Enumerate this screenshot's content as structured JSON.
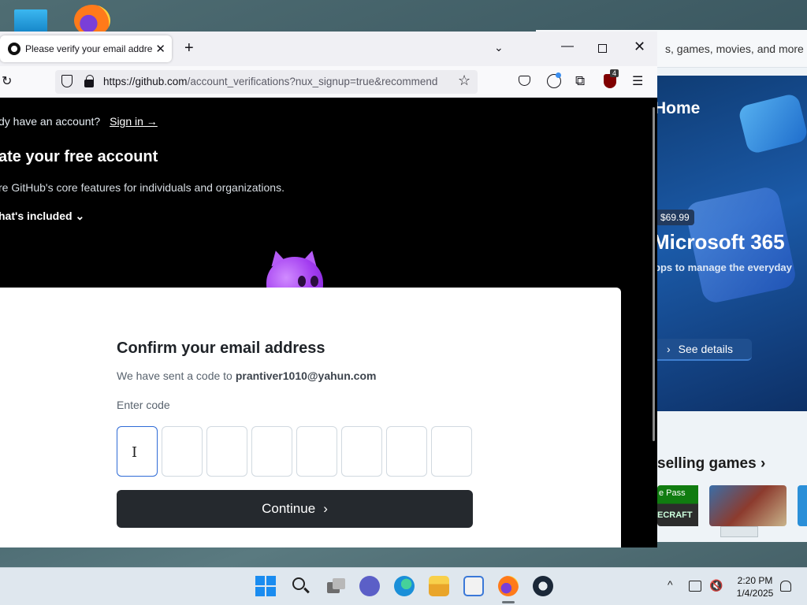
{
  "firefox": {
    "tab_title": "Please verify your email address",
    "url_host": "https://github.com",
    "url_path": "/account_verifications?nux_signup=true&recommend",
    "ublock_badge": "4"
  },
  "github": {
    "signin_prompt": "dy have an account?",
    "signin_link": "Sign in →",
    "create_title": "ate your free account",
    "create_sub": "re GitHub's core features for individuals and organizations.",
    "included": "hat's included",
    "card_title": "Confirm your email address",
    "sent_prefix": "We have sent a code to",
    "email": "prantiver1010@yahun.com",
    "enter_code_label": "Enter code",
    "code_boxes": [
      "",
      "",
      "",
      "",
      "",
      "",
      "",
      ""
    ],
    "continue_label": "Continue"
  },
  "store": {
    "search_text": "s, games, movies, and more",
    "home_label": "Home",
    "price": "$69.99",
    "product": "Microsoft 365",
    "tagline": "pps to manage the everyday",
    "details_label": "See details",
    "section_title": "selling games",
    "card_pass": "e Pass",
    "card_logo": "ECRAFT"
  },
  "taskbar": {
    "time": "2:20 PM",
    "date": "1/4/2025"
  }
}
